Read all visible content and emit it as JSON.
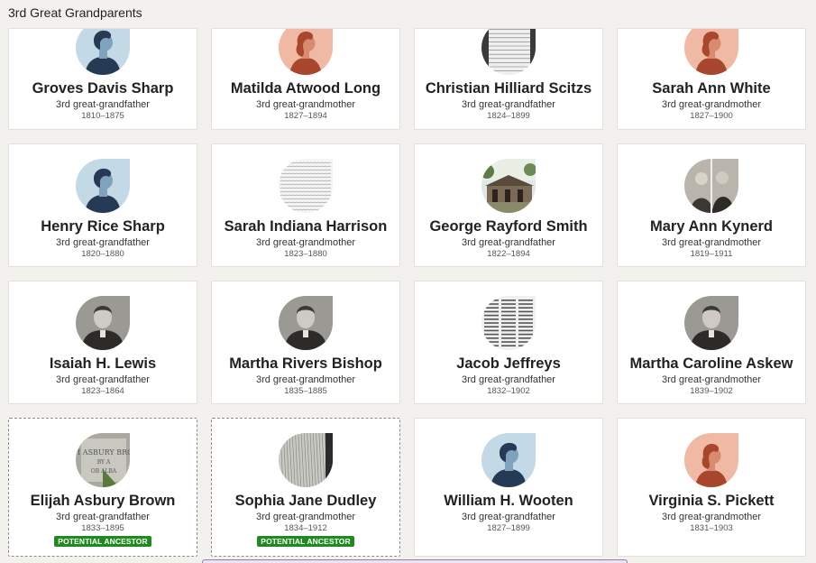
{
  "section": {
    "title": "3rd Great Grandparents"
  },
  "colors": {
    "male_bg": "#c3d9e6",
    "male_fig": "#263a55",
    "male_face": "#7fa3bd",
    "female_bg": "#efb9a4",
    "female_fig": "#a8472e",
    "female_face": "#d98b70",
    "badge": "#1f8a1f"
  },
  "people": [
    {
      "name": "Groves Davis Sharp",
      "relation": "3rd great-grandfather",
      "dates": "1810–1875",
      "avatar": "male-silhouette-icon"
    },
    {
      "name": "Matilda Atwood Long",
      "relation": "3rd great-grandmother",
      "dates": "1827–1894",
      "avatar": "female-silhouette-icon"
    },
    {
      "name": "Christian Hilliard Scitzs",
      "relation": "3rd great-grandfather",
      "dates": "1824–1899",
      "avatar": "document-photo-icon"
    },
    {
      "name": "Sarah Ann White",
      "relation": "3rd great-grandmother",
      "dates": "1827–1900",
      "avatar": "female-silhouette-icon"
    },
    {
      "name": "Henry Rice Sharp",
      "relation": "3rd great-grandfather",
      "dates": "1820–1880",
      "avatar": "male-silhouette-icon"
    },
    {
      "name": "Sarah Indiana Harrison",
      "relation": "3rd great-grandmother",
      "dates": "1823–1880",
      "avatar": "handwriting-photo-icon"
    },
    {
      "name": "George Rayford Smith",
      "relation": "3rd great-grandfather",
      "dates": "1822–1894",
      "avatar": "house-photo-icon"
    },
    {
      "name": "Mary Ann Kynerd",
      "relation": "3rd great-grandmother",
      "dates": "1819–1911",
      "avatar": "couple-photo-icon"
    },
    {
      "name": "Isaiah H. Lewis",
      "relation": "3rd great-grandfather",
      "dates": "1823–1864",
      "avatar": "portrait-photo-icon"
    },
    {
      "name": "Martha Rivers Bishop",
      "relation": "3rd great-grandmother",
      "dates": "1835–1885",
      "avatar": "portrait-photo-icon"
    },
    {
      "name": "Jacob Jeffreys",
      "relation": "3rd great-grandfather",
      "dates": "1832–1902",
      "avatar": "newspaper-photo-icon"
    },
    {
      "name": "Martha Caroline Askew",
      "relation": "3rd great-grandmother",
      "dates": "1839–1902",
      "avatar": "portrait-photo-icon"
    },
    {
      "name": "Elijah Asbury Brown",
      "relation": "3rd great-grandfather",
      "dates": "1833–1895",
      "avatar": "gravestone-photo-icon",
      "badge": "POTENTIAL ANCESTOR"
    },
    {
      "name": "Sophia Jane Dudley",
      "relation": "3rd great-grandmother",
      "dates": "1834–1912",
      "avatar": "wood-photo-icon",
      "badge": "POTENTIAL ANCESTOR"
    },
    {
      "name": "William H. Wooten",
      "relation": "3rd great-grandfather",
      "dates": "1827–1899",
      "avatar": "male-silhouette-icon"
    },
    {
      "name": "Virginia S. Pickett",
      "relation": "3rd great-grandmother",
      "dates": "1831–1903",
      "avatar": "female-silhouette-icon"
    }
  ]
}
